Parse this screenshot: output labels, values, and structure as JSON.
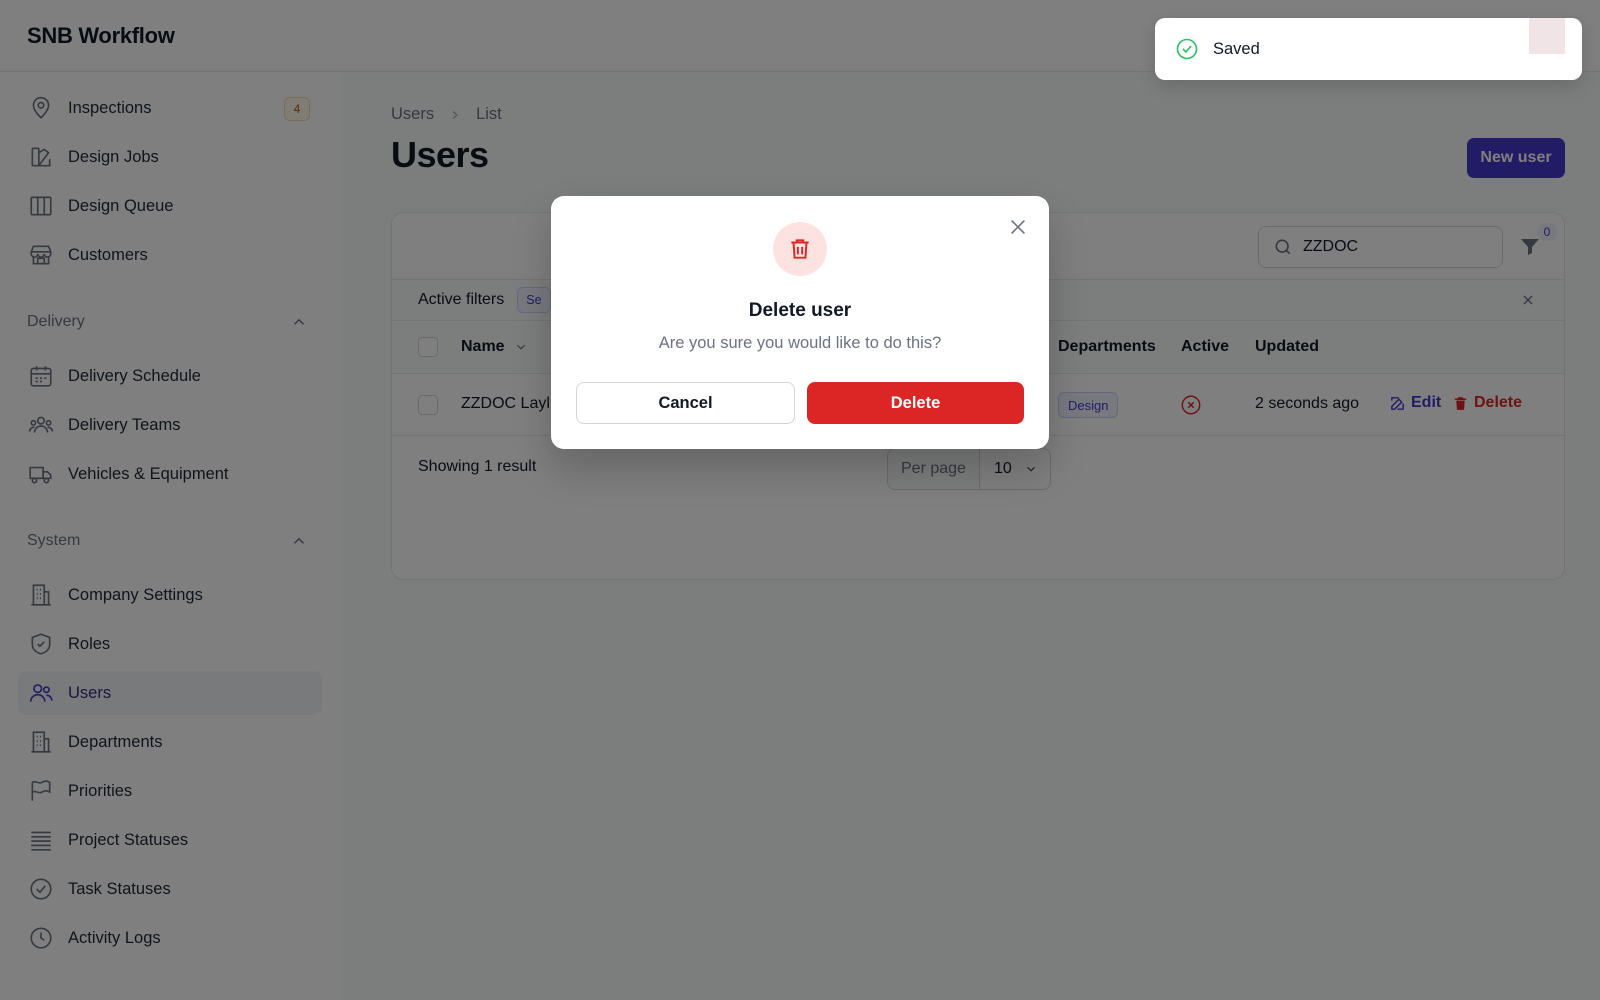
{
  "app": {
    "title": "SNB Workflow"
  },
  "sidebar": {
    "top_items": [
      {
        "label": "Inspections",
        "badge": "4",
        "icon": "map-pin-icon"
      },
      {
        "label": "Design Jobs",
        "icon": "design-icon"
      },
      {
        "label": "Design Queue",
        "icon": "columns-icon"
      },
      {
        "label": "Customers",
        "icon": "storefront-icon"
      }
    ],
    "groups": [
      {
        "label": "Delivery",
        "items": [
          {
            "label": "Delivery Schedule",
            "icon": "calendar-icon"
          },
          {
            "label": "Delivery Teams",
            "icon": "user-group-icon"
          },
          {
            "label": "Vehicles & Equipment",
            "icon": "truck-icon"
          }
        ]
      },
      {
        "label": "System",
        "items": [
          {
            "label": "Company Settings",
            "icon": "building-icon"
          },
          {
            "label": "Roles",
            "icon": "shield-check-icon"
          },
          {
            "label": "Users",
            "icon": "users-icon",
            "active": true
          },
          {
            "label": "Departments",
            "icon": "building-icon"
          },
          {
            "label": "Priorities",
            "icon": "flag-icon"
          },
          {
            "label": "Project Statuses",
            "icon": "bars-icon"
          },
          {
            "label": "Task Statuses",
            "icon": "check-circle-icon"
          },
          {
            "label": "Activity Logs",
            "icon": "clock-icon"
          }
        ]
      }
    ]
  },
  "main": {
    "breadcrumb": [
      "Users",
      "List"
    ],
    "title": "Users",
    "new_button": "New user",
    "search": {
      "value": "ZZDOC"
    },
    "filter_count": "0",
    "active_filters_label": "Active filters",
    "filter_chip": "Se",
    "table": {
      "columns": [
        "Name",
        "Departments",
        "Active",
        "Updated"
      ],
      "rows": [
        {
          "name": "ZZDOC Layl",
          "department": "Design",
          "active": false,
          "updated": "2 seconds ago"
        }
      ],
      "actions": {
        "edit": "Edit",
        "delete": "Delete"
      }
    },
    "footer": {
      "showing": "Showing 1 result",
      "per_page_label": "Per page",
      "per_page_value": "10"
    }
  },
  "toast": {
    "text": "Saved"
  },
  "modal": {
    "title": "Delete user",
    "description": "Are you sure you would like to do this?",
    "cancel": "Cancel",
    "confirm": "Delete"
  },
  "colors": {
    "brand": "#4338ca",
    "danger": "#dc2626",
    "success": "#22c55e",
    "overlay": "rgba(0,0,0,0.5)"
  }
}
